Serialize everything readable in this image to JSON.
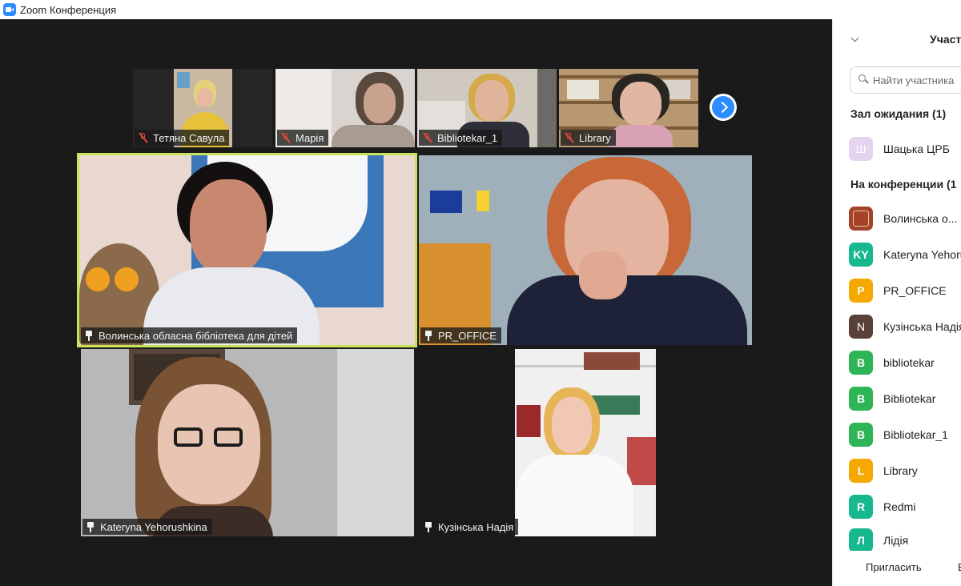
{
  "window": {
    "title": "Zoom Конференция"
  },
  "gallery": {
    "top_strip": [
      {
        "name": "Тетяна Савула",
        "muted": true
      },
      {
        "name": "Марія",
        "muted": true
      },
      {
        "name": "Bibliotekar_1",
        "muted": true
      },
      {
        "name": "Library",
        "muted": true
      }
    ],
    "main_tiles": [
      {
        "name": "Волинська обласна бібліотека для дітей",
        "pinned": true,
        "active_speaker": true
      },
      {
        "name": "PR_OFFICE",
        "pinned": true
      },
      {
        "name": "Kateryna Yehorushkina",
        "pinned": true
      },
      {
        "name": "Кузінська Надія",
        "pinned": true
      }
    ],
    "next_page_icon": "chevron-right-icon"
  },
  "participants_panel": {
    "title": "Участ",
    "search_placeholder": "Найти участника",
    "waiting_room": {
      "title": "Зал ожидания (1)",
      "items": [
        {
          "initials": "Ш",
          "name": "Шацька ЦРБ",
          "color": "#e6d3ef"
        }
      ]
    },
    "in_meeting": {
      "title": "На конференции (1",
      "items": [
        {
          "initials": "",
          "name": "Волинська о...",
          "color": "#a5432a"
        },
        {
          "initials": "KY",
          "name": "Kateryna Yehoru",
          "color": "#17b890"
        },
        {
          "initials": "P",
          "name": "PR_OFFICE",
          "color": "#f5a800"
        },
        {
          "initials": "N",
          "name": "Кузінська Надія",
          "color": "#5a4137"
        },
        {
          "initials": "B",
          "name": "bibliotekar",
          "color": "#2db556"
        },
        {
          "initials": "B",
          "name": "Bibliotekar",
          "color": "#2db556"
        },
        {
          "initials": "B",
          "name": "Bibliotekar_1",
          "color": "#2db556"
        },
        {
          "initials": "L",
          "name": "Library",
          "color": "#f5a800"
        },
        {
          "initials": "R",
          "name": "Redmi",
          "color": "#17b890"
        },
        {
          "initials": "Л",
          "name": "Лідія",
          "color": "#17b890"
        }
      ]
    },
    "footer": {
      "invite_label": "Пригласить",
      "more_label": "Е"
    }
  },
  "colors": {
    "active_speaker_border": "#c8e35a",
    "accent": "#2d8cff",
    "muted_icon": "#e8453c"
  }
}
